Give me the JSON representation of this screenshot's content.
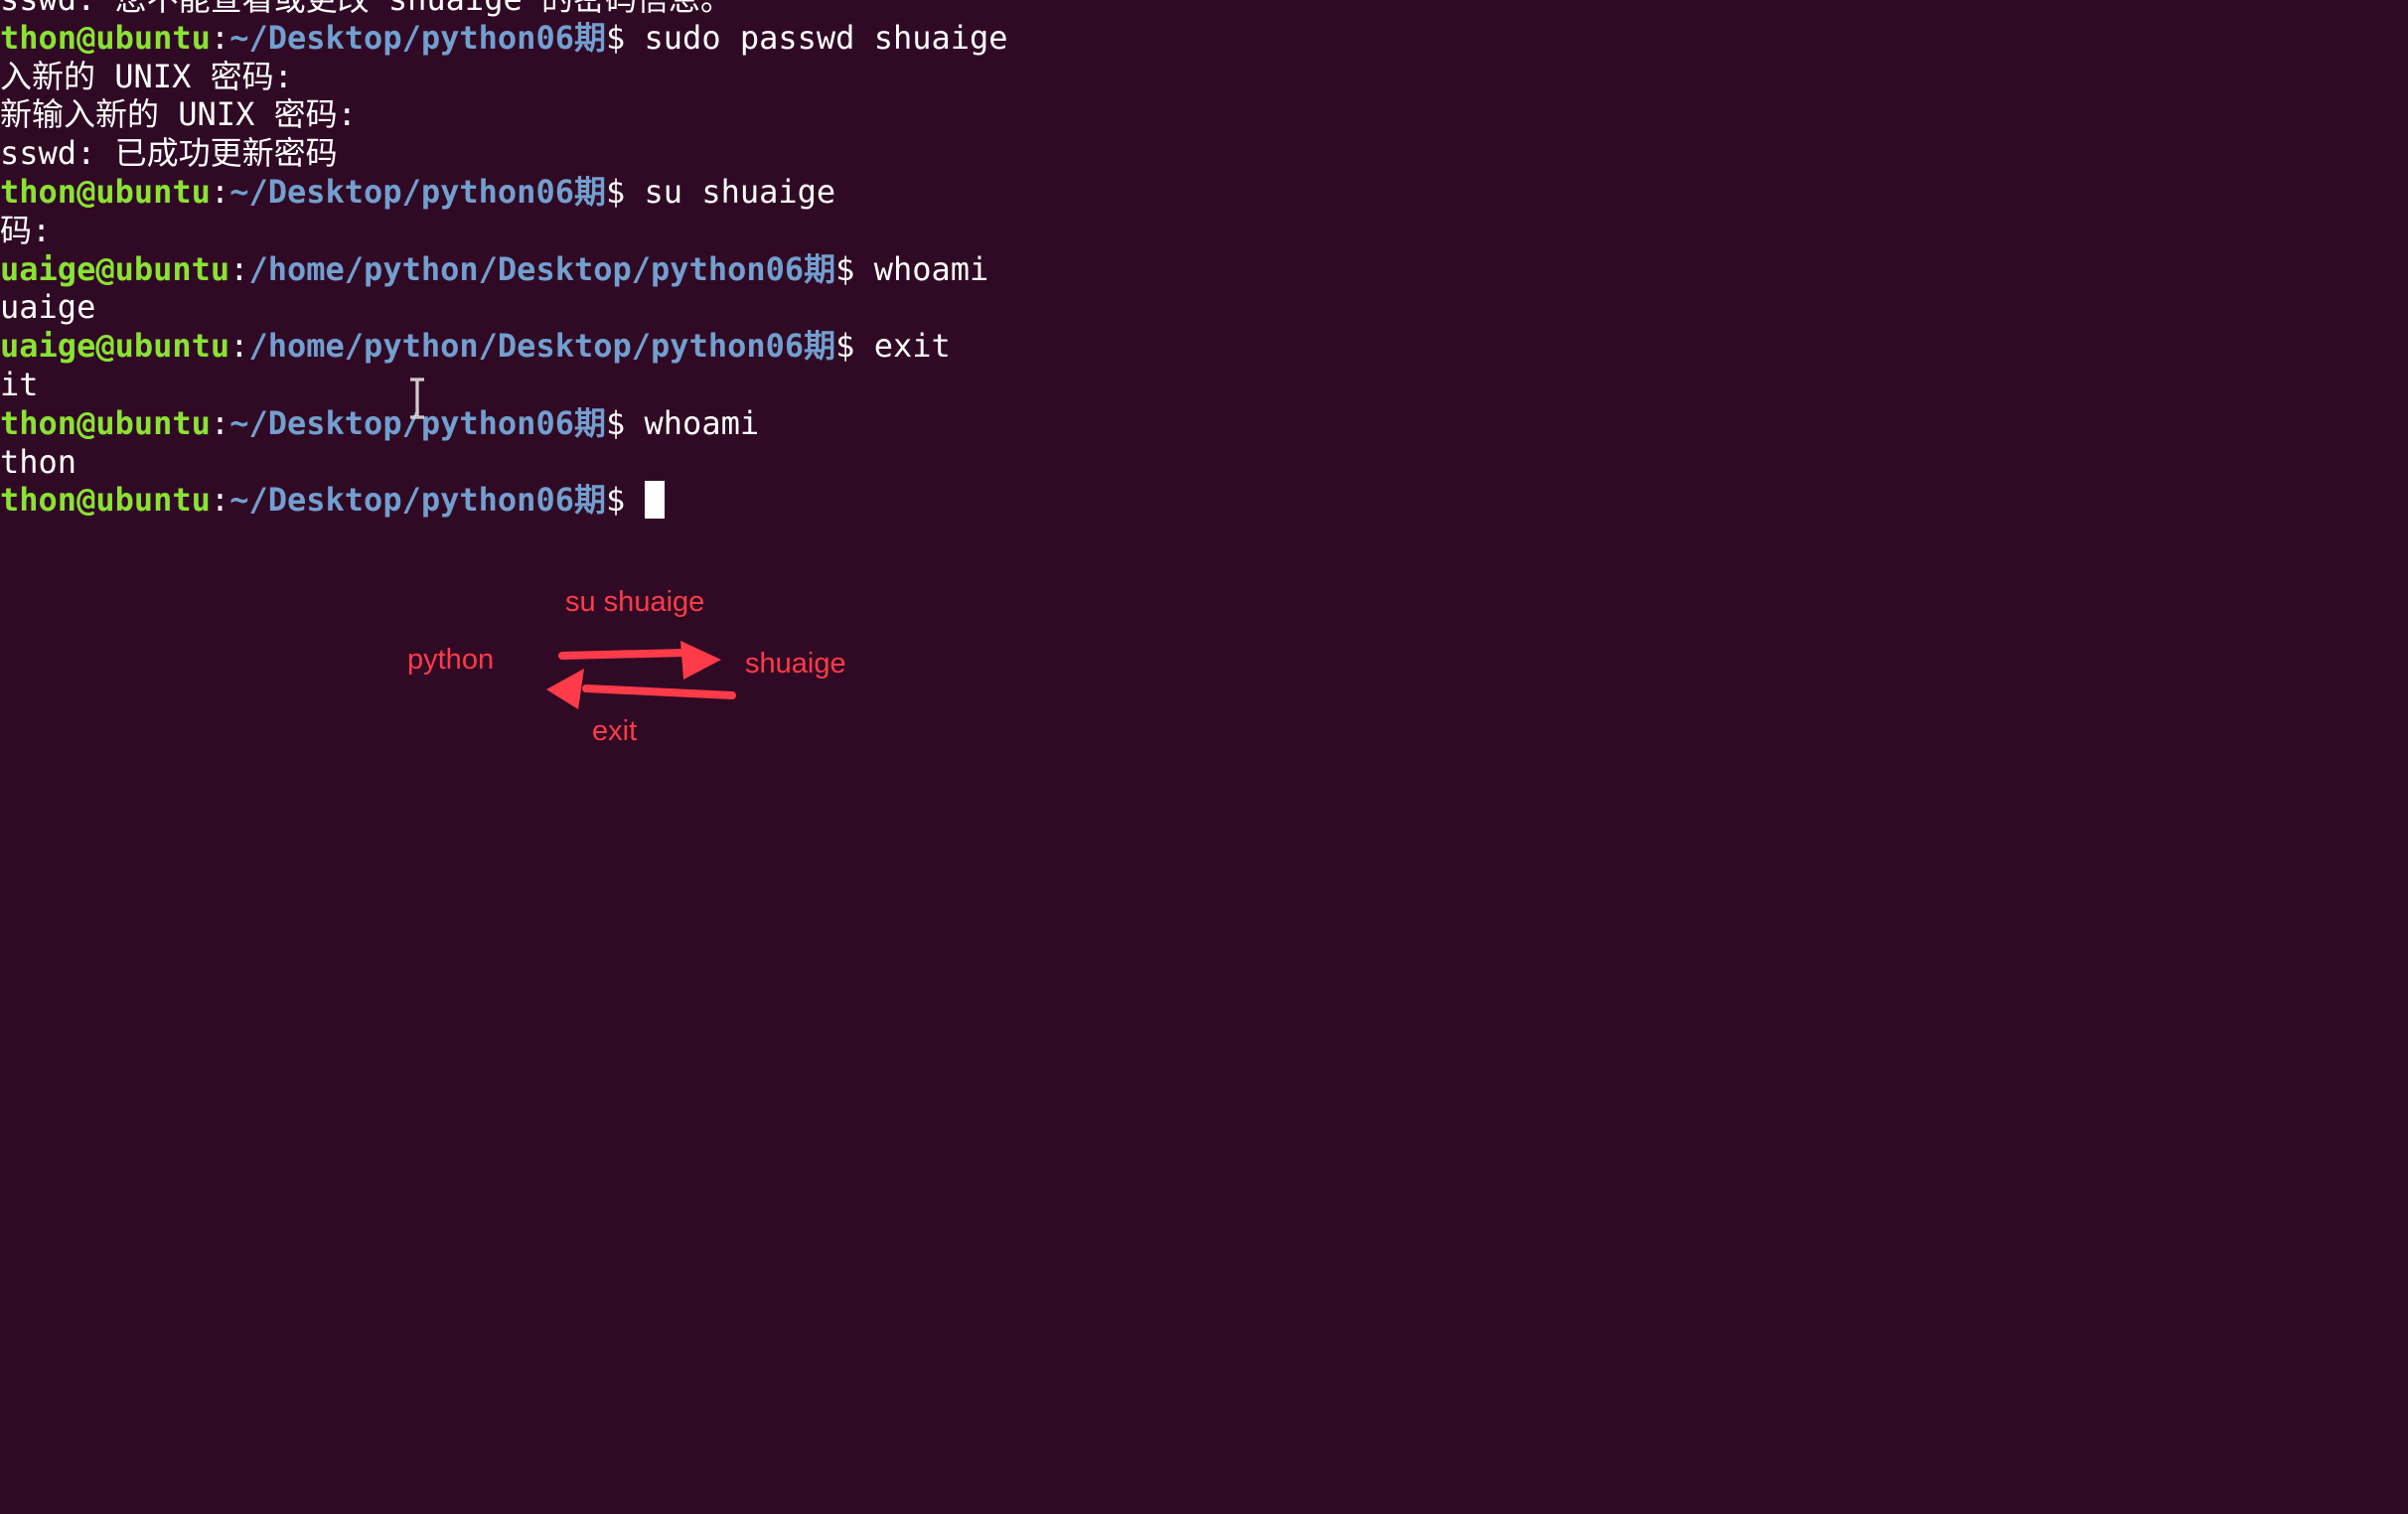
{
  "terminal": {
    "lines": [
      {
        "type": "output",
        "text": "sswd: 您不能查看或更改 shuaige 的密码信息。"
      },
      {
        "type": "prompt",
        "user": "thon@ubuntu",
        "sep": ":",
        "path": "~/Desktop/python06期",
        "dollar": "$ ",
        "cmd": "sudo passwd shuaige"
      },
      {
        "type": "output",
        "text": "入新的 UNIX 密码:"
      },
      {
        "type": "output",
        "text": "新输入新的 UNIX 密码:"
      },
      {
        "type": "output",
        "text": "sswd: 已成功更新密码"
      },
      {
        "type": "prompt",
        "user": "thon@ubuntu",
        "sep": ":",
        "path": "~/Desktop/python06期",
        "dollar": "$ ",
        "cmd": "su shuaige"
      },
      {
        "type": "output",
        "text": "码:"
      },
      {
        "type": "prompt",
        "user": "uaige@ubuntu",
        "sep": ":",
        "path": "/home/python/Desktop/python06期",
        "dollar": "$ ",
        "cmd": "whoami"
      },
      {
        "type": "output",
        "text": "uaige"
      },
      {
        "type": "prompt",
        "user": "uaige@ubuntu",
        "sep": ":",
        "path": "/home/python/Desktop/python06期",
        "dollar": "$ ",
        "cmd": "exit"
      },
      {
        "type": "output",
        "text": "it"
      },
      {
        "type": "prompt",
        "user": "thon@ubuntu",
        "sep": ":",
        "path": "~/Desktop/python06期",
        "dollar": "$ ",
        "cmd": "whoami"
      },
      {
        "type": "output",
        "text": "thon"
      },
      {
        "type": "prompt",
        "user": "thon@ubuntu",
        "sep": ":",
        "path": "~/Desktop/python06期",
        "dollar": "$ ",
        "cmd": "",
        "cursor": true
      }
    ]
  },
  "annotation": {
    "top_label": "su shuaige",
    "left_label": "python",
    "right_label": "shuaige",
    "bottom_label": "exit",
    "color": "#ff3b4a"
  },
  "colors": {
    "background": "#300a24",
    "user": "#8ae234",
    "path": "#729fcf",
    "text": "#ffffff"
  }
}
